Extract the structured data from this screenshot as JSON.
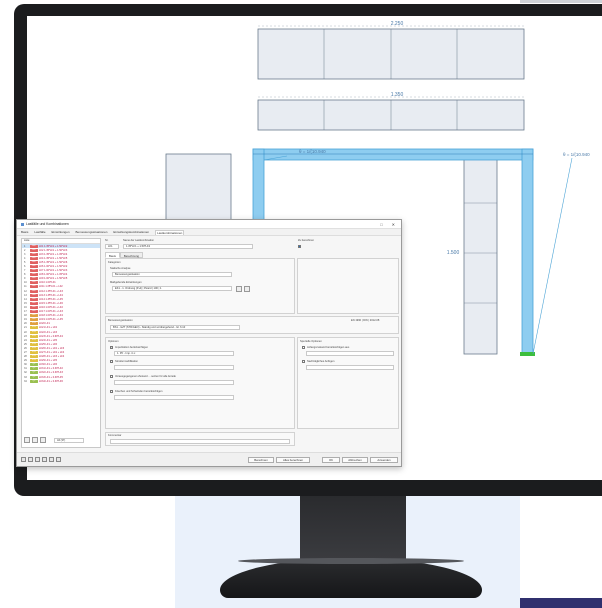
{
  "structure": {
    "dim_top": "2.250",
    "dim_mid": "1.350",
    "dim_side": "1.500",
    "beam_label_left": "θ = 1/(10.940",
    "beam_label_right": "θ = 1/(10.940",
    "colors": {
      "member": "#8ecdf0",
      "member_edge": "#4aa3d6",
      "load": "#e8ecf2",
      "load_edge": "#6a7a8c",
      "support": "#3cbe3c"
    }
  },
  "dialog": {
    "title": "Lastfälle und Kombinationen",
    "controls": [
      "□",
      "✕"
    ],
    "tabs": [
      "Basis",
      "Lastfälle",
      "Einwirkungen",
      "Bemessungssituationen",
      "Einwirkungskombinationen",
      "Lastkombinationen"
    ],
    "active_tab": "Lastkombinationen",
    "list_header": "Liste",
    "rows": [
      {
        "no": "1",
        "tag": "GEO",
        "tag_color": "#e06060",
        "text": "LK1 1.35*LF1 + 1.50*LF2"
      },
      {
        "no": "2",
        "tag": "GEO",
        "tag_color": "#e06060",
        "text": "LK2 1.35*LF1 + 1.50*LF3"
      },
      {
        "no": "3",
        "tag": "GEO",
        "tag_color": "#e06060",
        "text": "LK3 1.35*LF1 + 1.05*LF4"
      },
      {
        "no": "4",
        "tag": "GEO",
        "tag_color": "#e06060",
        "text": "LK4 1.35*LF1 + 1.50*LF5"
      },
      {
        "no": "5",
        "tag": "GEO",
        "tag_color": "#e06060",
        "text": "LK5 1.35*LF1 + 1.50*LF6"
      },
      {
        "no": "6",
        "tag": "GEO",
        "tag_color": "#e06060",
        "text": "LK6 1.00*LF1 + 1.50*LF2"
      },
      {
        "no": "7",
        "tag": "GEO",
        "tag_color": "#e06060",
        "text": "LK7 1.00*LF1 + 1.50*LF3"
      },
      {
        "no": "8",
        "tag": "GEO",
        "tag_color": "#e06060",
        "text": "LK8 1.00*LF1 + 1.05*LF4"
      },
      {
        "no": "9",
        "tag": "GEO",
        "tag_color": "#e06060",
        "text": "LK9 1.00*LF1 + 1.50*LF5"
      },
      {
        "no": "10",
        "tag": "GEO",
        "tag_color": "#e06060",
        "text": "LK10 1.00*LF1"
      },
      {
        "no": "11",
        "tag": "GEO",
        "tag_color": "#e06060",
        "text": "LK11 1.35*LF1 + LF2"
      },
      {
        "no": "12",
        "tag": "GEO",
        "tag_color": "#e06060",
        "text": "LK12 1.35*LF1 + LF3"
      },
      {
        "no": "13",
        "tag": "GEO",
        "tag_color": "#e06060",
        "text": "LK13 1.35*LF1 + LF4"
      },
      {
        "no": "14",
        "tag": "GEO",
        "tag_color": "#e06060",
        "text": "LK14 1.35*LF1 + LF5"
      },
      {
        "no": "15",
        "tag": "GEO",
        "tag_color": "#e06060",
        "text": "LK15 1.35*LF1 + LF6"
      },
      {
        "no": "16",
        "tag": "GEO",
        "tag_color": "#e06060",
        "text": "LK16 1.00*LF1 + LF2"
      },
      {
        "no": "17",
        "tag": "GEO",
        "tag_color": "#e06060",
        "text": "LK17 1.00*LF1 + LF3"
      },
      {
        "no": "18",
        "tag": "GEO",
        "tag_color": "#e0a040",
        "text": "LK18 1.00*LF1 + LF4"
      },
      {
        "no": "19",
        "tag": "GEO",
        "tag_color": "#e0a040",
        "text": "LK19 1.00*LF1 + LF5"
      },
      {
        "no": "20",
        "tag": "STR",
        "tag_color": "#e0a040",
        "text": "LK20 LF1"
      },
      {
        "no": "21",
        "tag": "STR",
        "tag_color": "#e0c040",
        "text": "LK21 LF1 + LF2"
      },
      {
        "no": "22",
        "tag": "STR",
        "tag_color": "#e0c040",
        "text": "LK22 LF1 + LF3"
      },
      {
        "no": "23",
        "tag": "STR",
        "tag_color": "#e0c040",
        "text": "LK23 LF1 + 0.60*LF4"
      },
      {
        "no": "24",
        "tag": "STR",
        "tag_color": "#e0c040",
        "text": "LK24 LF1 + LF5"
      },
      {
        "no": "25",
        "tag": "STR",
        "tag_color": "#e0c040",
        "text": "LK25 LF1 + LF6"
      },
      {
        "no": "26",
        "tag": "STR",
        "tag_color": "#e0c040",
        "text": "LK26 LF1 + LF2 + LF3"
      },
      {
        "no": "27",
        "tag": "STR",
        "tag_color": "#e0c040",
        "text": "LK27 LF1 + LF2 + LF4"
      },
      {
        "no": "28",
        "tag": "STR",
        "tag_color": "#e0c040",
        "text": "LK28 LF1 + LF3 + LF4"
      },
      {
        "no": "29",
        "tag": "STR",
        "tag_color": "#e0c040",
        "text": "LK29 LF1 + LF5"
      },
      {
        "no": "30",
        "tag": "QP",
        "tag_color": "#9ac050",
        "text": "LK30 LF1 + LF6"
      },
      {
        "no": "31",
        "tag": "QP",
        "tag_color": "#9ac050",
        "text": "LK31 LF1 + 0.30*LF2"
      },
      {
        "no": "32",
        "tag": "QP",
        "tag_color": "#9ac050",
        "text": "LK32 LF1 + 0.30*LF3"
      },
      {
        "no": "33",
        "tag": "QP",
        "tag_color": "#9ac050",
        "text": "LK33 LF1 + 0.30*LF5"
      },
      {
        "no": "34",
        "tag": "QP",
        "tag_color": "#9ac050",
        "text": "LK34 LF1 + 0.30*LF6"
      }
    ],
    "list_footer_field": "All (37)",
    "no_label": "Nr.",
    "no_value": "LK1",
    "name_label": "Name der Lastkombination",
    "name_value": "1.35*LF1 + 1.50*LF2",
    "to_solve_label": "Zu berechnen",
    "sub_tabs": [
      "Basis",
      "Berechnung"
    ],
    "category_label": "Kategorien",
    "category_value": "Bemessungssituation",
    "static_label": "Statische Analyse",
    "action_label": "Maßgebende Einwirkungen",
    "action_value": "EK1 - 1. Ordnung (P-Δ) | Picard | 100 | 1",
    "design_label": "Bemessungssituation",
    "design_norm": "EN 1990 | DIN | 2012-08",
    "design_value": "BS1 - GZT (STR/GEO) - Ständig und vorübergehend - Gl. 6.10",
    "options_label": "Optionen",
    "option1": "Imperfektion berücksichtigen",
    "option1_value": "1. PF - Imp. in x",
    "option2": "Strukturmodifikation",
    "option3": "Vorausgegangenen Zustand ... setzen für alle Anteile",
    "option4": "Kriechen und Schwinden berücksichtigen",
    "special_label": "Spezielle Optionen",
    "special1": "Anfangszustand berücksichtigen aus",
    "special2": "Nachträgliches Anfügen",
    "comment_label": "Kommentar",
    "buttons": {
      "calc": "Berechnen",
      "calc_all": "Alles berechnen",
      "ok": "OK",
      "cancel": "Abbrechen",
      "apply": "Anwenden"
    }
  }
}
